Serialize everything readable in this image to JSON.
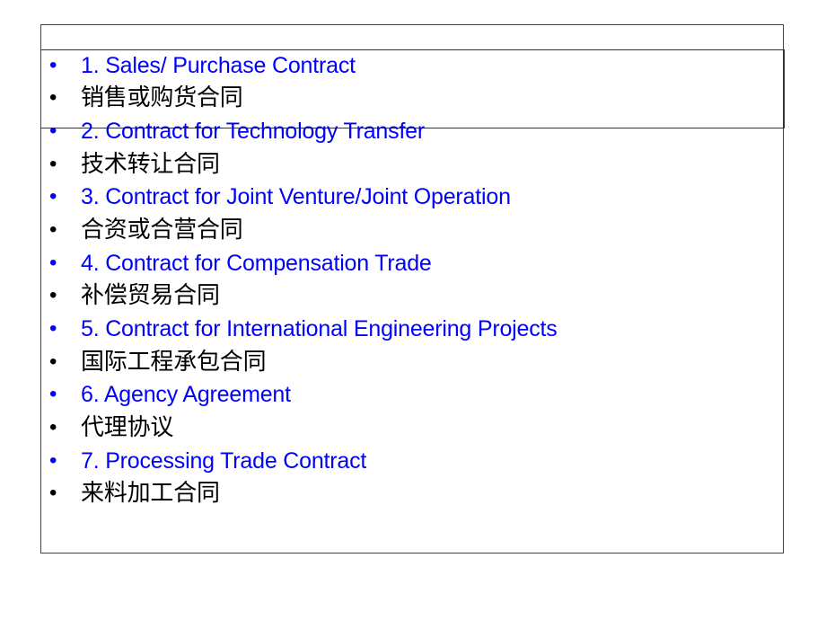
{
  "slide": {
    "colors": {
      "english_text": "#0000ff",
      "chinese_text": "#000000",
      "bullet_en": "#0000ff",
      "bullet_zh": "#000000"
    },
    "bullet_glyph": "•",
    "items": [
      {
        "lang": "en",
        "text": "1. Sales/ Purchase Contract"
      },
      {
        "lang": "zh",
        "text": "销售或购货合同"
      },
      {
        "lang": "en",
        "text": "2. Contract for Technology Transfer"
      },
      {
        "lang": "zh",
        "text": "技术转让合同"
      },
      {
        "lang": "en",
        "text": "3. Contract for Joint Venture/Joint Operation"
      },
      {
        "lang": "zh",
        "text": "合资或合营合同"
      },
      {
        "lang": "en",
        "text": "4. Contract for Compensation Trade"
      },
      {
        "lang": "zh",
        "text": "补偿贸易合同"
      },
      {
        "lang": "en",
        "text": "5. Contract for International Engineering Projects"
      },
      {
        "lang": "zh",
        "text": "国际工程承包合同"
      },
      {
        "lang": "en",
        "text": "6. Agency Agreement"
      },
      {
        "lang": "zh",
        "text": "代理协议"
      },
      {
        "lang": "en",
        "text": "7. Processing Trade Contract"
      },
      {
        "lang": "zh",
        "text": "来料加工合同"
      }
    ]
  }
}
